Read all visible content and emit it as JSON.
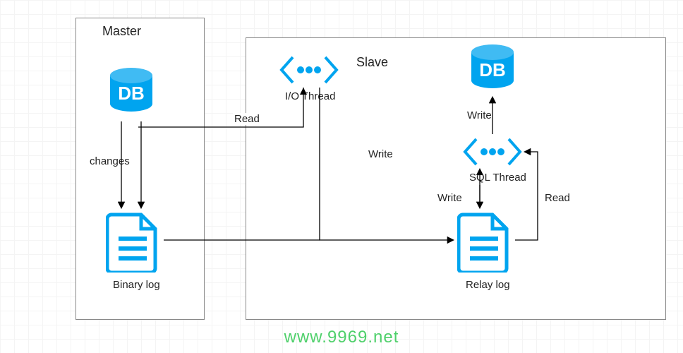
{
  "master": {
    "title": "Master"
  },
  "slave": {
    "title": "Slave"
  },
  "db1": {
    "text": "DB"
  },
  "db2": {
    "text": "DB"
  },
  "binary_log": {
    "label": "Binary log"
  },
  "relay_log": {
    "label": "Relay log"
  },
  "io_thread": {
    "label": "I/O Thread"
  },
  "sql_thread": {
    "label": "SQL Thread"
  },
  "edges": {
    "changes": "changes",
    "read1": "Read",
    "write1": "Write",
    "write2": "Write",
    "read2": "Read",
    "write3": "Write"
  },
  "watermark": "www.9969.net",
  "colors": {
    "accent": "#00A4EF"
  }
}
